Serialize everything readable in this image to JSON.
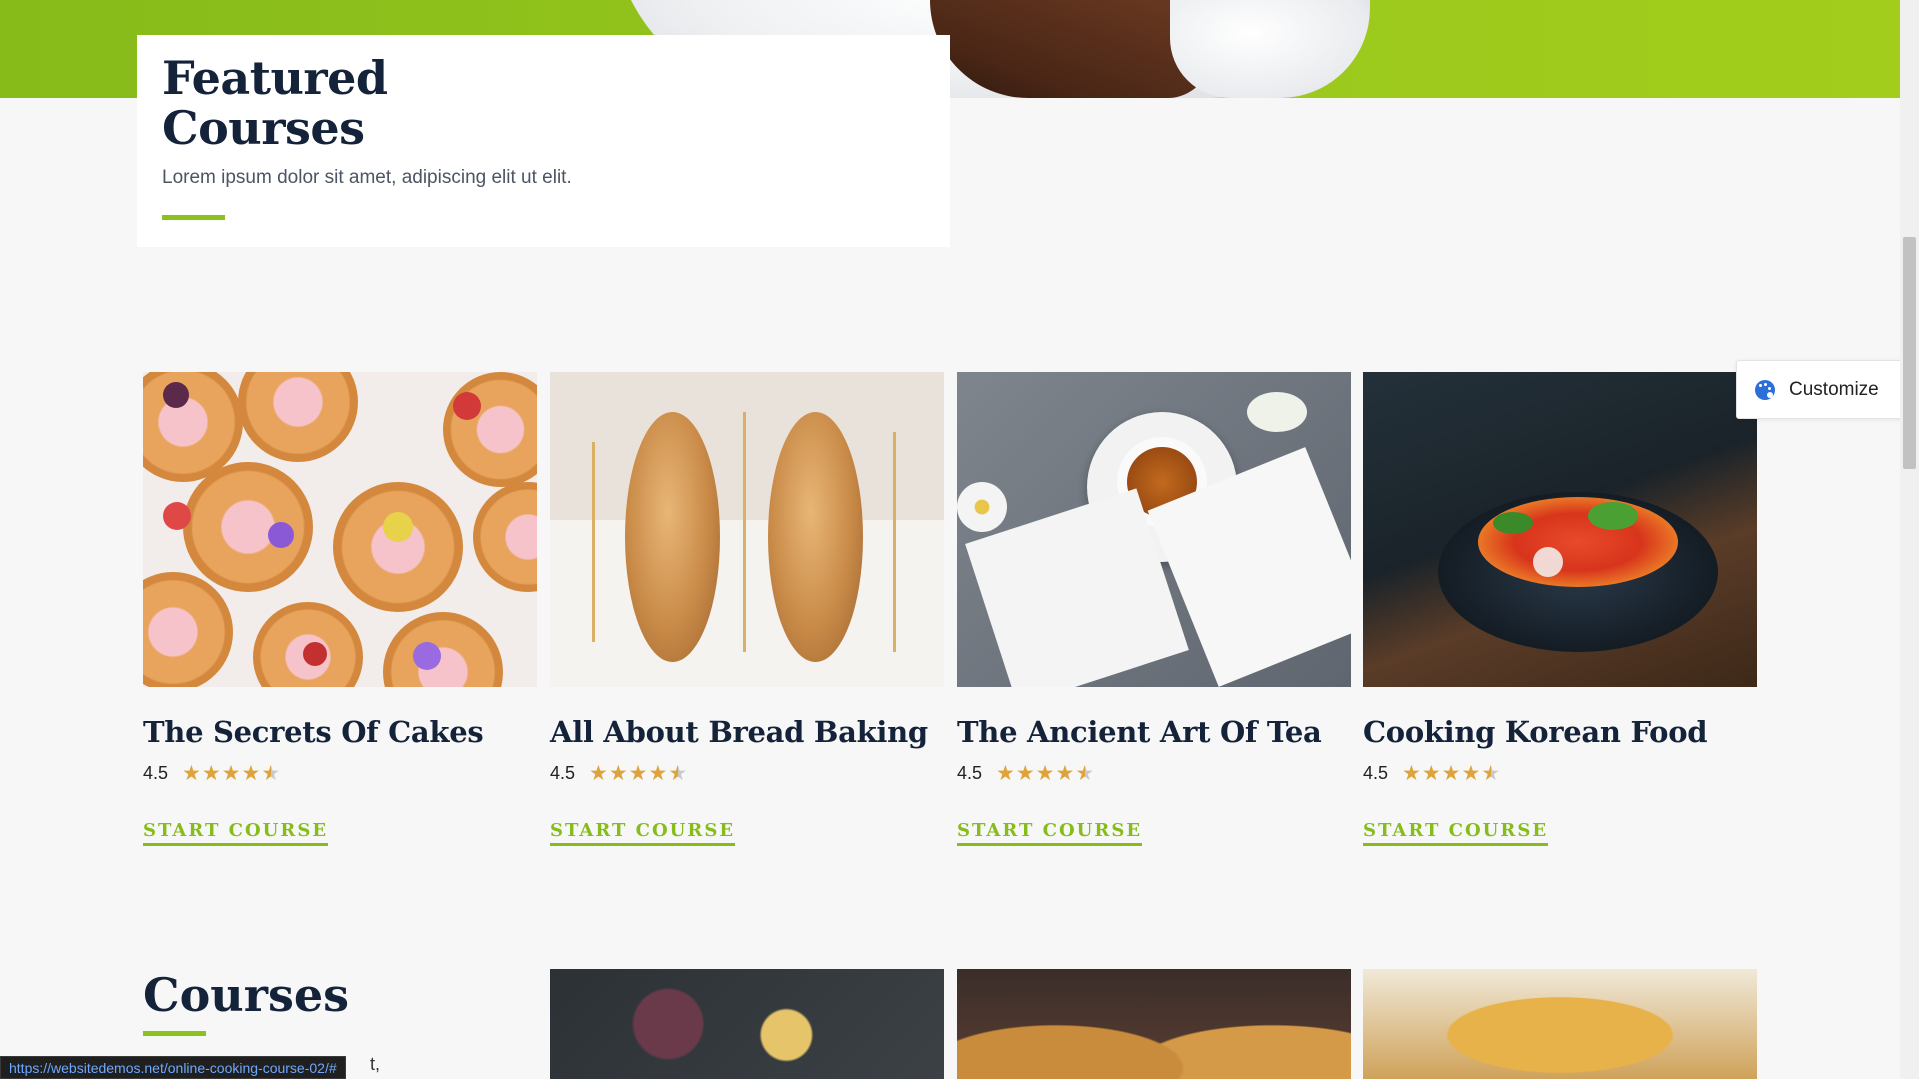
{
  "featured": {
    "title": "Featured Courses",
    "description": "Lorem ipsum dolor sit amet, adipiscing elit ut elit."
  },
  "courses": [
    {
      "title": "The Secrets Of Cakes",
      "rating": "4.5",
      "cta": "START COURSE"
    },
    {
      "title": "All About Bread Baking",
      "rating": "4.5",
      "cta": "START COURSE"
    },
    {
      "title": "The Ancient Art Of Tea",
      "rating": "4.5",
      "cta": "START COURSE"
    },
    {
      "title": "Cooking Korean Food",
      "rating": "4.5",
      "cta": "START COURSE"
    }
  ],
  "courses_section": {
    "title": "Courses",
    "partial_text": "t,"
  },
  "customize": {
    "label": "Customize",
    "icon": "palette-icon"
  },
  "status_bar": {
    "url": "https://websitedemos.net/online-cooking-course-02/#"
  },
  "colors": {
    "accent": "#8cc21c",
    "heading": "#14233a",
    "star": "#e0a33b"
  },
  "star_rating_value": 4.5
}
